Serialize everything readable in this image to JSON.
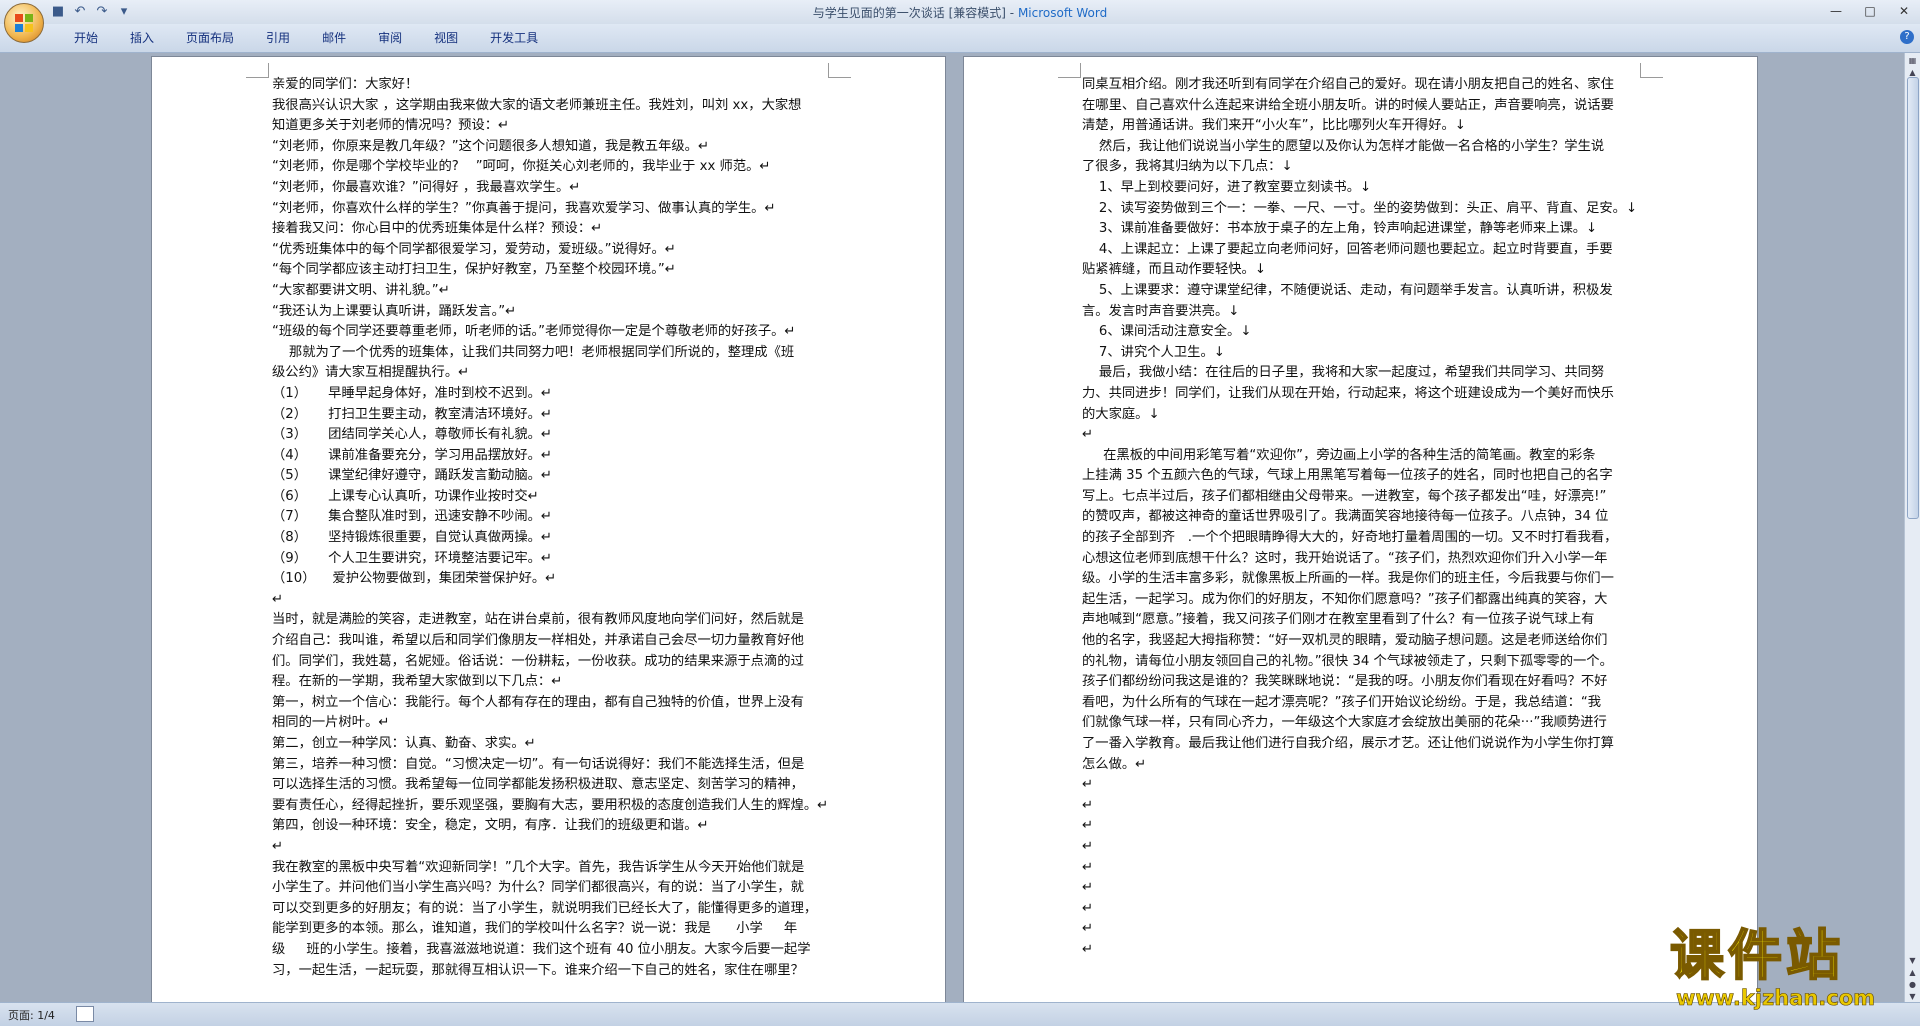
{
  "window": {
    "title": "与学生见面的第一次谈话 [兼容模式]",
    "app_name": "Microsoft Word"
  },
  "ribbon": {
    "tabs": [
      "开始",
      "插入",
      "页面布局",
      "引用",
      "邮件",
      "审阅",
      "视图",
      "开发工具"
    ]
  },
  "page1": {
    "lines": [
      "亲爱的同学们：大家好！",
      "我很高兴认识大家 ，这学期由我来做大家的语文老师兼班主任。我姓刘，叫刘 xx，大家想",
      "知道更多关于刘老师的情况吗？预设：↵",
      "“刘老师，你原来是教几年级？”这个问题很多人想知道，我是教五年级。↵",
      "“刘老师，你是哪个学校毕业的?    ”呵呵，你挺关心刘老师的，我毕业于 xx 师范。↵",
      "“刘老师，你最喜欢谁？”问得好 ，我最喜欢学生。↵",
      "“刘老师，你喜欢什么样的学生？”你真善于提问，我喜欢爱学习、做事认真的学生。↵",
      "接着我又问：你心目中的优秀班集体是什么样？预设：↵",
      "“优秀班集体中的每个同学都很爱学习，爱劳动，爱班级。”说得好。↵",
      "“每个同学都应该主动打扫卫生，保护好教室，乃至整个校园环境。”↵",
      "“大家都要讲文明、讲礼貌。”↵",
      "“我还认为上课要认真听讲，踊跃发言。”↵",
      "“班级的每个同学还要尊重老师，听老师的话。”老师觉得你一定是个尊敬老师的好孩子。↵",
      "    那就为了一个优秀的班集体，让我们共同努力吧！老师根据同学们所说的，整理成《班",
      "级公约》请大家互相提醒执行。↵",
      "（1）     早睡早起身体好，准时到校不迟到。↵",
      "（2）     打扫卫生要主动，教室清洁环境好。↵",
      "（3）     团结同学关心人，尊敬师长有礼貌。↵",
      "（4）     课前准备要充分，学习用品摆放好。↵",
      "（5）     课堂纪律好遵守，踊跃发言勤动脑。↵",
      "（6）     上课专心认真听，功课作业按时交↵",
      "（7）     集合整队准时到，迅速安静不吵闹。↵",
      "（8）     坚持锻炼很重要，自觉认真做两操。↵",
      "（9）     个人卫生要讲究，环境整洁要记牢。↵",
      "（10）    爱护公物要做到，集团荣誉保护好。↵",
      "↵",
      "当时，就是满脸的笑容，走进教室，站在讲台桌前，很有教师风度地向学们问好，然后就是",
      "介绍自己：我叫谁，希望以后和同学们像朋友一样相处，并承诺自己会尽一切力量教育好他",
      "们。同学们，我姓葛，名妮娅。俗话说：一份耕耘，一份收获。成功的结果来源于点滴的过",
      "程。在新的一学期，我希望大家做到以下几点：↵",
      "第一，树立一个信心：我能行。每个人都有存在的理由，都有自己独特的价值，世界上没有",
      "相同的一片树叶。↵",
      "第二，创立一种学风：认真、勤奋、求实。↵",
      "第三，培养一种习惯：自觉。“习惯决定一切”。有一句话说得好：我们不能选择生活，但是",
      "可以选择生活的习惯。我希望每一位同学都能发扬积极进取、意志坚定、刻苦学习的精神，",
      "要有责任心，经得起挫折，要乐观坚强，要胸有大志，要用积极的态度创造我们人生的辉煌。↵",
      "第四，创设一种环境：安全，稳定，文明，有序．让我们的班级更和谐。↵",
      "↵",
      "我在教室的黑板中央写着“欢迎新同学！”几个大字。首先，我告诉学生从今天开始他们就是",
      "小学生了。并问他们当小学生高兴吗？为什么？同学们都很高兴，有的说：当了小学生，就",
      "可以交到更多的好朋友；有的说：当了小学生，就说明我们已经长大了，能懂得更多的道理，",
      "能学到更多的本领。那么，谁知道，我们的学校叫什么名字？说一说：我是      小学     年",
      "级     班的小学生。接着，我喜滋滋地说道：我们这个班有 40 位小朋友。大家今后要一起学",
      "习，一起生活，一起玩耍，那就得互相认识一下。谁来介绍一下自己的姓名，家住在哪里？"
    ]
  },
  "page2": {
    "lines": [
      "同桌互相介绍。刚才我还听到有同学在介绍自己的爱好。现在请小朋友把自己的姓名、家住",
      "在哪里、自己喜欢什么连起来讲给全班小朋友听。讲的时候人要站正，声音要响亮，说话要",
      "清楚，用普通话讲。我们来开“小火车”，比比哪列火车开得好。↓",
      "    然后，我让他们说说当小学生的愿望以及你认为怎样才能做一名合格的小学生？学生说",
      "了很多，我将其归纳为以下几点：↓",
      "    1、早上到校要问好，进了教室要立刻读书。↓",
      "    2、读写姿势做到三个一：一拳、一尺、一寸。坐的姿势做到：头正、肩平、背直、足安。↓",
      "    3、课前准备要做好：书本放于桌子的左上角，铃声响起进课堂，静等老师来上课。↓",
      "    4、上课起立：上课了要起立向老师问好，回答老师问题也要起立。起立时背要直，手要",
      "贴紧裤缝，而且动作要轻快。↓",
      "    5、上课要求：遵守课堂纪律，不随便说话、走动，有问题举手发言。认真听讲，积极发",
      "言。发言时声音要洪亮。↓",
      "    6、课间活动注意安全。↓",
      "    7、讲究个人卫生。↓",
      "    最后，我做小结：在往后的日子里，我将和大家一起度过，希望我们共同学习、共同努",
      "力、共同进步！同学们，让我们从现在开始，行动起来，将这个班建设成为一个美好而快乐",
      "的大家庭。↓",
      "↵",
      "     在黑板的中间用彩笔写着“欢迎你”，旁边画上小学的各种生活的简笔画。教室的彩条",
      "上挂满 35 个五颜六色的气球，气球上用黑笔写着每一位孩子的姓名，同时也把自己的名字",
      "写上。七点半过后，孩子们都相继由父母带来。一进教室，每个孩子都发出“哇，好漂亮!”",
      "的赞叹声，都被这神奇的童话世界吸引了。我满面笑容地接待每一位孩子。八点钟，34 位",
      "的孩子全部到齐   .一个个把眼睛睁得大大的，好奇地打量着周围的一切。又不时打看我看，",
      "心想这位老师到底想干什么？这时，我开始说话了。“孩子们，热烈欢迎你们升入小学一年",
      "级。小学的生活丰富多彩，就像黑板上所画的一样。我是你们的班主任，今后我要与你们一",
      "起生活，一起学习。成为你们的好朋友，不知你们愿意吗？”孩子们都露出纯真的笑容，大",
      "声地喊到“愿意。”接着，我又问孩子们刚才在教室里看到了什么？有一位孩子说气球上有",
      "他的名字，我竖起大拇指称赞：“好一双机灵的眼睛，爱动脑子想问题。这是老师送给你们",
      "的礼物，请每位小朋友领回自己的礼物。”很快 34 个气球被领走了，只剩下孤零零的一个。",
      "孩子们都纷纷问我这是谁的？我笑眯眯地说：“是我的呀。小朋友你们看现在好看吗？不好",
      "看吧，为什么所有的气球在一起才漂亮呢？”孩子们开始议论纷纷。于是，我总结道：“我",
      "们就像气球一样，只有同心齐力，一年级这个大家庭才会绽放出美丽的花朵···”我顺势进行",
      "了一番入学教育。最后我让他们进行自我介绍，展示才艺。还让他们说说作为小学生你打算",
      "怎么做。↵",
      "↵",
      "↵",
      "↵",
      "↵",
      "↵",
      "↵",
      "↵",
      "↵",
      "↵"
    ]
  },
  "statusbar": {
    "page_info": "页面: 1/4"
  },
  "watermark": {
    "text": "课件站",
    "url": "www.kjzhan.com"
  }
}
